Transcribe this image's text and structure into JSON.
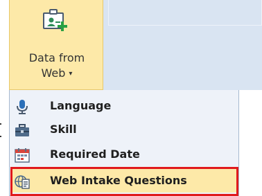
{
  "ribbon": {
    "data_from_web": {
      "line1": "Data from",
      "line2": "Web",
      "caret": "▾",
      "icon": "import-data-icon"
    }
  },
  "menu": {
    "items": [
      {
        "label": "Language",
        "icon": "microphone-icon"
      },
      {
        "label": "Skill",
        "icon": "toolbox-icon"
      },
      {
        "label": "Required Date",
        "icon": "calendar-icon"
      },
      {
        "label": "Web Intake Questions",
        "icon": "web-form-icon",
        "highlighted": true
      }
    ]
  },
  "colors": {
    "button_hover": "#fde9a8",
    "menu_bg": "#eef2f9",
    "ribbon_bg": "#d9e4f2",
    "highlight_border": "#e0191c"
  }
}
